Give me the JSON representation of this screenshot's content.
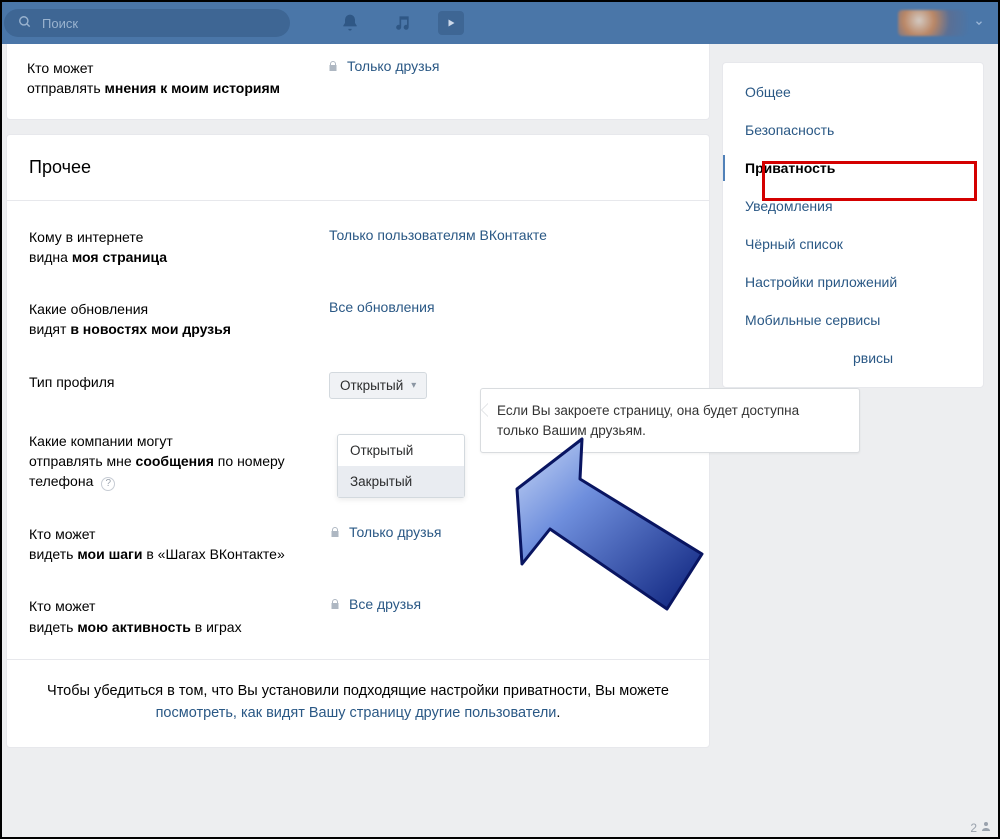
{
  "header": {
    "search_placeholder": "Поиск"
  },
  "top_row": {
    "label_line1": "Кто может",
    "label_line2_prefix": "отправлять ",
    "label_line2_bold": "мнения к моим историям",
    "value": "Только друзья"
  },
  "section_title": "Прочее",
  "rows": [
    {
      "label_line1": "Кому в интернете",
      "label_line2_prefix": "видна ",
      "label_line2_bold": "моя страница",
      "value": "Только пользователям ВКонтакте",
      "locked": false
    },
    {
      "label_line1": "Какие обновления",
      "label_line2_prefix": "видят ",
      "label_line2_bold": "в новостях мои друзья",
      "value": "Все обновления",
      "locked": false
    },
    {
      "label_line1": "Тип профиля",
      "dropdown_selected": "Открытый",
      "dropdown_options": [
        "Открытый",
        "Закрытый"
      ],
      "tooltip": "Если Вы закроете страницу, она будет доступна только Вашим друзьям."
    },
    {
      "label_line1": "Какие компании могут",
      "label_line2_prefix": "отправлять мне ",
      "label_line2_bold": "сообщения",
      "label_line2_suffix": " по номеру телефона",
      "help": true
    },
    {
      "label_line1": "Кто может",
      "label_line2_prefix": "видеть ",
      "label_line2_bold": "мои шаги",
      "label_line2_suffix": " в «Шагах ВКонтакте»",
      "value": "Только друзья",
      "locked": true
    },
    {
      "label_line1": "Кто может",
      "label_line2_prefix": "видеть ",
      "label_line2_bold": "мою активность",
      "label_line2_suffix": " в играх",
      "value": "Все друзья",
      "locked": true
    }
  ],
  "footnote": {
    "text_before": "Чтобы убедиться в том, что Вы установили подходящие настройки приватности, Вы можете ",
    "link": "посмотреть, как видят Вашу страницу другие пользователи",
    "text_after": "."
  },
  "sidebar": {
    "items": [
      {
        "label": "Общее"
      },
      {
        "label": "Безопасность"
      },
      {
        "label": "Приватность",
        "active": true
      },
      {
        "label": "Уведомления"
      },
      {
        "label": "Чёрный список"
      },
      {
        "label": "Настройки приложений"
      },
      {
        "label": "Мобильные сервисы"
      },
      {
        "label": "рвисы"
      }
    ]
  },
  "badge_count": "2"
}
